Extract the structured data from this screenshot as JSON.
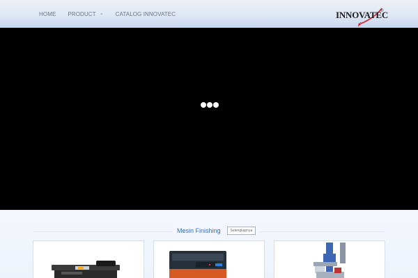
{
  "nav": {
    "home": "HOME",
    "product": "PRODUCT",
    "catalog": "CATALOG INNOVATEC"
  },
  "logo": {
    "text": "INNOVATEC",
    "reg": "®"
  },
  "section": {
    "title": "Mesin Finishing",
    "more_label": "Selengkapnya"
  },
  "colors": {
    "accent": "#3b6db3",
    "logo_red": "#d4232a",
    "video_bg": "#000000"
  }
}
